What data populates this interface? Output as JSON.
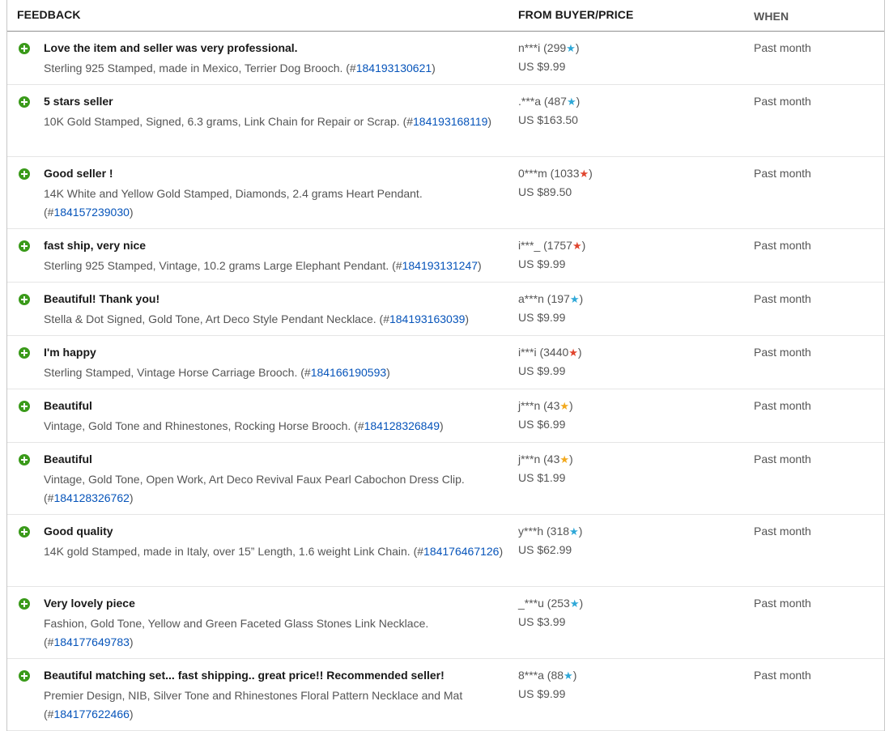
{
  "header": {
    "feedback": "FEEDBACK",
    "from_buyer_price": "FROM BUYER/PRICE",
    "when": "WHEN"
  },
  "rows": [
    {
      "comment": "Love the item and seller was very professional.",
      "item_text": "Sterling 925 Stamped, made in Mexico, Terrier Dog Brooch. (#",
      "item_id": "184193130621",
      "item_close": ")",
      "buyer": "n***i (299",
      "rating_star": "★",
      "star_color": "#2fa8d8",
      "buyer_close": ")",
      "price": "US $9.99",
      "when": "Past month"
    },
    {
      "comment": "5 stars seller",
      "item_text": "10K Gold Stamped, Signed, 6.3 grams, Link Chain for Repair or Scrap. (#",
      "item_id": "184193168119",
      "item_close": ")",
      "buyer": ".***a (487",
      "rating_star": "★",
      "star_color": "#2fa8d8",
      "buyer_close": ")",
      "price": "US $163.50",
      "when": "Past month"
    },
    {
      "comment": "Good seller !",
      "item_text": "14K White and Yellow Gold Stamped, Diamonds, 2.4 grams Heart Pendant. (#",
      "item_id": "184157239030",
      "item_close": ")",
      "buyer": "0***m (1033",
      "rating_star": "★",
      "star_color": "#e0452e",
      "buyer_close": ")",
      "price": "US $89.50",
      "when": "Past month"
    },
    {
      "comment": "fast ship, very nice",
      "item_text": "Sterling 925 Stamped, Vintage, 10.2 grams Large Elephant Pendant. (#",
      "item_id": "184193131247",
      "item_close": ")",
      "buyer": "i***_ (1757",
      "rating_star": "★",
      "star_color": "#e0452e",
      "buyer_close": ")",
      "price": "US $9.99",
      "when": "Past month"
    },
    {
      "comment": "Beautiful! Thank you!",
      "item_text": "Stella & Dot Signed, Gold Tone, Art Deco Style Pendant Necklace. (#",
      "item_id": "184193163039",
      "item_close": ")",
      "buyer": "a***n (197",
      "rating_star": "★",
      "star_color": "#2fa8d8",
      "buyer_close": ")",
      "price": "US $9.99",
      "when": "Past month"
    },
    {
      "comment": "I'm happy",
      "item_text": "Sterling Stamped, Vintage Horse Carriage Brooch. (#",
      "item_id": "184166190593",
      "item_close": ")",
      "buyer": "i***i (3440",
      "rating_star": "★",
      "star_color": "#e0452e",
      "buyer_close": ")",
      "price": "US $9.99",
      "when": "Past month"
    },
    {
      "comment": "Beautiful",
      "item_text": "Vintage, Gold Tone and Rhinestones, Rocking Horse Brooch. (#",
      "item_id": "184128326849",
      "item_close": ")",
      "buyer": "j***n (43",
      "rating_star": "★",
      "star_color": "#f2a91d",
      "buyer_close": ")",
      "price": "US $6.99",
      "when": "Past month"
    },
    {
      "comment": "Beautiful",
      "item_text": "Vintage, Gold Tone, Open Work, Art Deco Revival Faux Pearl Cabochon Dress Clip. (#",
      "item_id": "184128326762",
      "item_close": ")",
      "buyer": "j***n (43",
      "rating_star": "★",
      "star_color": "#f2a91d",
      "buyer_close": ")",
      "price": "US $1.99",
      "when": "Past month"
    },
    {
      "comment": "Good quality",
      "item_text": "14K gold Stamped, made in Italy, over 15” Length, 1.6 weight Link Chain. (#",
      "item_id": "184176467126",
      "item_close": ")",
      "buyer": "y***h (318",
      "rating_star": "★",
      "star_color": "#2fa8d8",
      "buyer_close": ")",
      "price": "US $62.99",
      "when": "Past month"
    },
    {
      "comment": "Very lovely piece",
      "item_text": "Fashion, Gold Tone, Yellow and Green Faceted Glass Stones Link Necklace. (#",
      "item_id": "184177649783",
      "item_close": ")",
      "buyer": "_***u (253",
      "rating_star": "★",
      "star_color": "#2fa8d8",
      "buyer_close": ")",
      "price": "US $3.99",
      "when": "Past month"
    },
    {
      "comment": "Beautiful matching set... fast shipping.. great price!! Recommended seller!",
      "item_text": "Premier Design, NIB, Silver Tone and Rhinestones Floral Pattern Necklace and Mat (#",
      "item_id": "184177622466",
      "item_close": ")",
      "buyer": "8***a (88",
      "rating_star": "★",
      "star_color": "#2fa8d8",
      "buyer_close": ")",
      "price": "US $9.99",
      "when": "Past month"
    }
  ],
  "colors": {
    "positive_icon": "#3a9a1a",
    "link": "#0654ba",
    "muted_text": "#555555"
  }
}
